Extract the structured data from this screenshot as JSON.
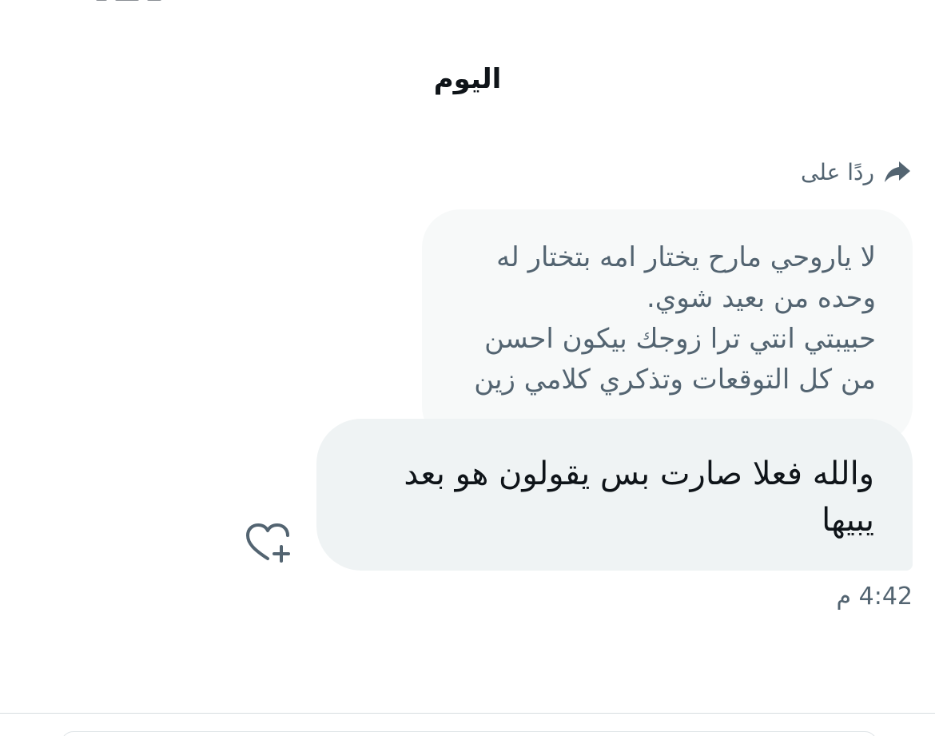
{
  "conversation": {
    "date_label": "اليوم",
    "reply_label": "ردًا على",
    "quoted_message": "لا ياروحي مارح يختار امه بتختار له\nوحده من بعيد شوي.\nحبيبتي انتي ترا زوجك بيكون احسن\nمن كل التوقعات وتذكري كلامي زين",
    "message_text": "والله فعلا صارت بس يقولون هو بعد يبيها",
    "timestamp": "4:42 م"
  },
  "icons": {
    "reply": "reply-arrow-icon",
    "reaction": "heart-plus-icon"
  },
  "colors": {
    "primary_text": "#0f1419",
    "secondary_text": "#536471",
    "quoted_bubble": "#f7f9f9",
    "message_bubble": "#eff3f4",
    "divider": "#d8dde1"
  }
}
